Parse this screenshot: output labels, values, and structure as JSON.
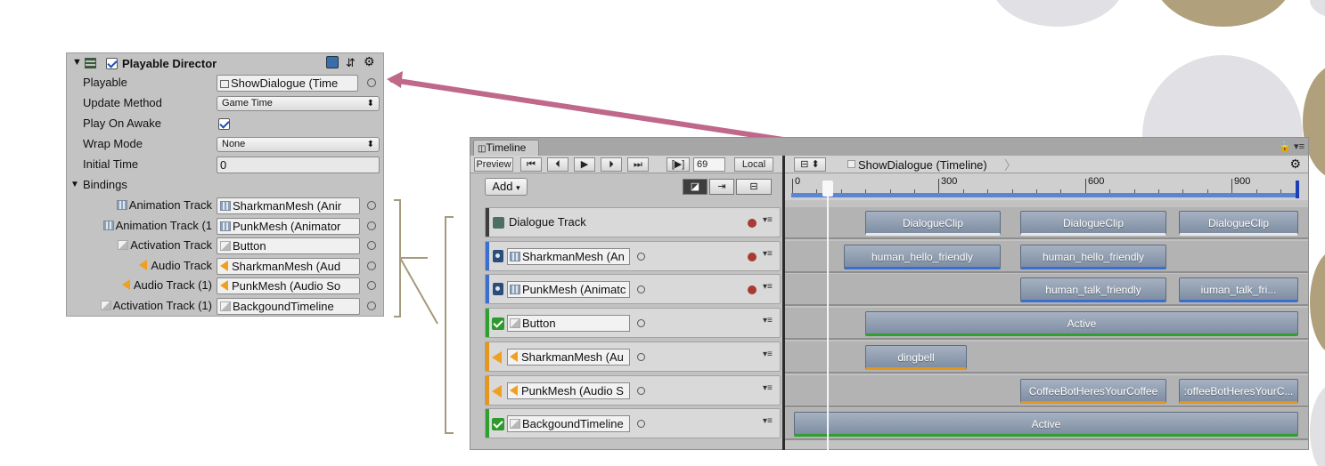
{
  "inspector": {
    "header_title": "Playable Director",
    "rows": {
      "playable_label": "Playable",
      "playable_value": "ShowDialogue (Time",
      "update_method_label": "Update Method",
      "update_method_value": "Game Time",
      "play_on_awake_label": "Play On Awake",
      "wrap_mode_label": "Wrap Mode",
      "wrap_mode_value": "None",
      "initial_time_label": "Initial Time",
      "initial_time_value": "0",
      "bindings_label": "Bindings"
    },
    "bindings": [
      {
        "label": "Animation Track",
        "value": "SharkmanMesh (Anir",
        "icon": "animation-icon"
      },
      {
        "label": "Animation Track (1",
        "value": "PunkMesh (Animator",
        "icon": "animation-icon"
      },
      {
        "label": "Activation Track",
        "value": "Button",
        "icon": "activation-icon"
      },
      {
        "label": "Audio Track",
        "value": "SharkmanMesh (Aud",
        "icon": "audio-icon"
      },
      {
        "label": "Audio Track (1)",
        "value": "PunkMesh (Audio So",
        "icon": "audio-icon"
      },
      {
        "label": "Activation Track (1)",
        "value": "BackgoundTimeline",
        "icon": "activation-icon"
      }
    ]
  },
  "timeline": {
    "tab_label": "Timeline",
    "toolbar": {
      "preview_label": "Preview",
      "frame_value": "69",
      "local_label": "Local",
      "add_label": "Add",
      "asset_name": "ShowDialogue (Timeline)"
    },
    "ruler_labels": [
      "0",
      "300",
      "600",
      "900"
    ],
    "tracks": [
      {
        "name": "Dialogue Track",
        "kind": "dialogue",
        "color": "#3d3d3d"
      },
      {
        "name": "SharkmanMesh (An",
        "kind": "animation",
        "color": "#3a6fd0"
      },
      {
        "name": "PunkMesh (Animatc",
        "kind": "animation",
        "color": "#3a6fd0"
      },
      {
        "name": "Button",
        "kind": "activation",
        "color": "#2fa02f"
      },
      {
        "name": "SharkmanMesh (Au",
        "kind": "audio",
        "color": "#e3961a"
      },
      {
        "name": "PunkMesh (Audio S",
        "kind": "audio",
        "color": "#e3961a"
      },
      {
        "name": "BackgoundTimeline",
        "kind": "activation",
        "color": "#2fa02f"
      }
    ],
    "clips": {
      "dialogue": [
        "DialogueClip",
        "DialogueClip",
        "DialogueClip"
      ],
      "sharkman_anim": [
        "human_hello_friendly",
        "human_hello_friendly"
      ],
      "punk_anim": [
        "human_talk_friendly",
        "iuman_talk_fri..."
      ],
      "button": [
        "Active"
      ],
      "sharkman_audio": [
        "dingbell"
      ],
      "punk_audio": [
        "CoffeeBotHeresYourCoffee",
        ":offeeBotHeresYourC..."
      ],
      "background": [
        "Active"
      ]
    }
  },
  "colors": {
    "arrow": "#c0688a",
    "bracket": "#a59a7a",
    "deco_gray": "#e1e1e5",
    "deco_gold": "#b0a17c"
  }
}
